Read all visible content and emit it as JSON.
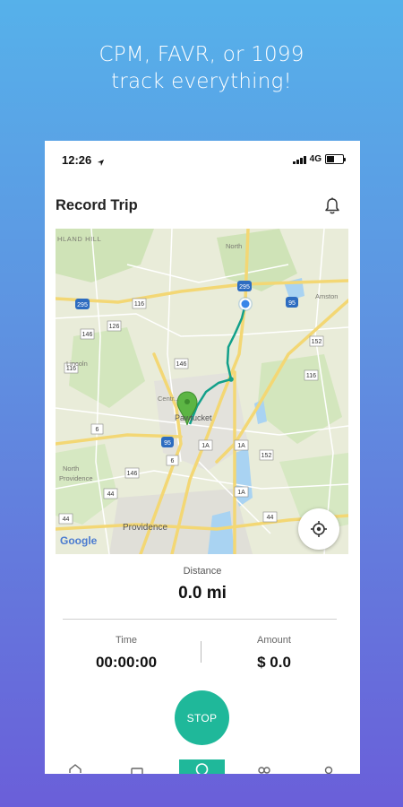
{
  "promo": {
    "line1": "CPM, FAVR, or 1099",
    "line2": "track everything!"
  },
  "status_bar": {
    "time": "12:26",
    "network": "4G"
  },
  "header": {
    "title": "Record Trip"
  },
  "map": {
    "labels": {
      "hill": "HLAND HILL",
      "north": "North",
      "amston": "Amston",
      "lincoln": "Lincoln",
      "central": "Centr...",
      "pawtucket": "Pawtucket",
      "north_prov": "North",
      "providence_area": "Providence",
      "providence": "Providence",
      "google": "Google"
    },
    "shields": [
      "295",
      "295",
      "116",
      "146",
      "95",
      "126",
      "116",
      "146",
      "152",
      "116",
      "95",
      "1A",
      "1A",
      "152",
      "146",
      "44",
      "44",
      "6",
      "44",
      "1A",
      "6"
    ]
  },
  "trip": {
    "distance_label": "Distance",
    "distance_value": "0.0 mi",
    "time_label": "Time",
    "time_value": "00:00:00",
    "amount_label": "Amount",
    "amount_value": "$ 0.0",
    "stop_label": "STOP"
  },
  "colors": {
    "accent": "#1fb89a",
    "route": "#12a08a",
    "pin": "#5cb544"
  }
}
